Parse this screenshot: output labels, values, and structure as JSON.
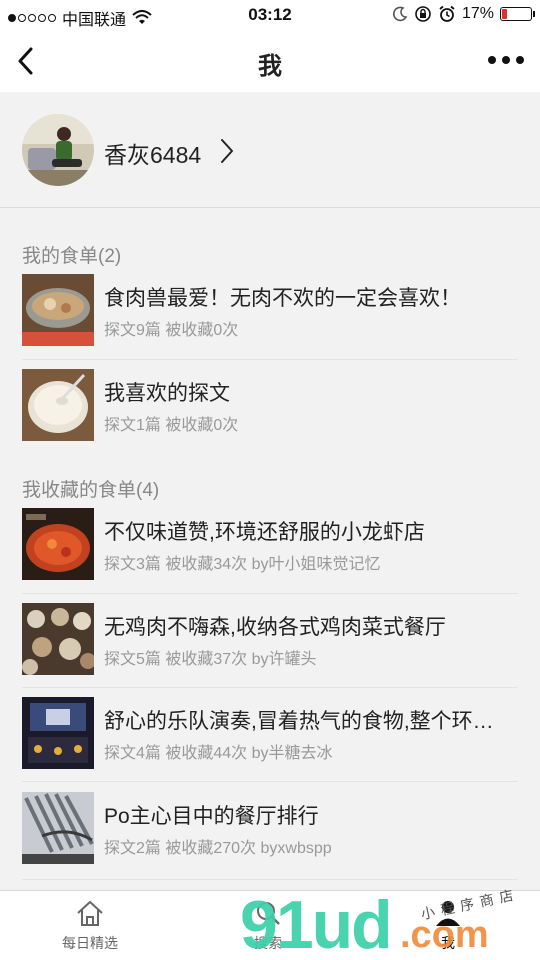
{
  "status_bar": {
    "carrier": "中国联通",
    "time": "03:12",
    "battery_percent": "17%",
    "battery_level": 0.17,
    "icons": [
      "signal-icon",
      "wifi-icon",
      "moon-icon",
      "rotation-lock-icon",
      "alarm-icon",
      "battery-icon"
    ],
    "battery_color": "#e0312a"
  },
  "nav": {
    "title": "我",
    "back_icon": "chevron-left-icon",
    "more_icon": "more-dots-icon"
  },
  "profile": {
    "name": "香灰6484",
    "chevron_icon": "chevron-right-icon"
  },
  "my_lists": {
    "title": "我的食单(2)",
    "items": [
      {
        "title": "食肉兽最爱！无肉不欢的一定会喜欢！",
        "meta": "探文9篇  被收藏0次"
      },
      {
        "title": "我喜欢的探文",
        "meta": "探文1篇  被收藏0次"
      }
    ]
  },
  "saved_lists": {
    "title": "我收藏的食单(4)",
    "items": [
      {
        "title": "不仅味道赞,环境还舒服的小龙虾店",
        "meta": "探文3篇  被收藏34次  by叶小姐味觉记忆"
      },
      {
        "title": "无鸡肉不嗨森,收纳各式鸡肉菜式餐厅",
        "meta": "探文5篇  被收藏37次  by许罐头"
      },
      {
        "title": "舒心的乐队演奏,冒着热气的食物,整个环境都很好",
        "meta": "探文4篇  被收藏44次  by半糖去冰"
      },
      {
        "title": "Po主心目中的餐厅排行",
        "meta": "探文2篇  被收藏270次  byxwbspp"
      }
    ]
  },
  "tab_bar": {
    "tabs": [
      {
        "label": "每日精选",
        "icon": "home-icon"
      },
      {
        "label": "搜索",
        "icon": "search-icon"
      },
      {
        "label": "我",
        "icon": "person-icon"
      }
    ]
  },
  "watermark": {
    "text": "91ud",
    "suffix": ".com",
    "small": "小程序商店"
  },
  "colors": {
    "accent_watermark": "#3ad0a8",
    "watermark_dot": "#f08a3a",
    "background": "#f2f2f2"
  }
}
